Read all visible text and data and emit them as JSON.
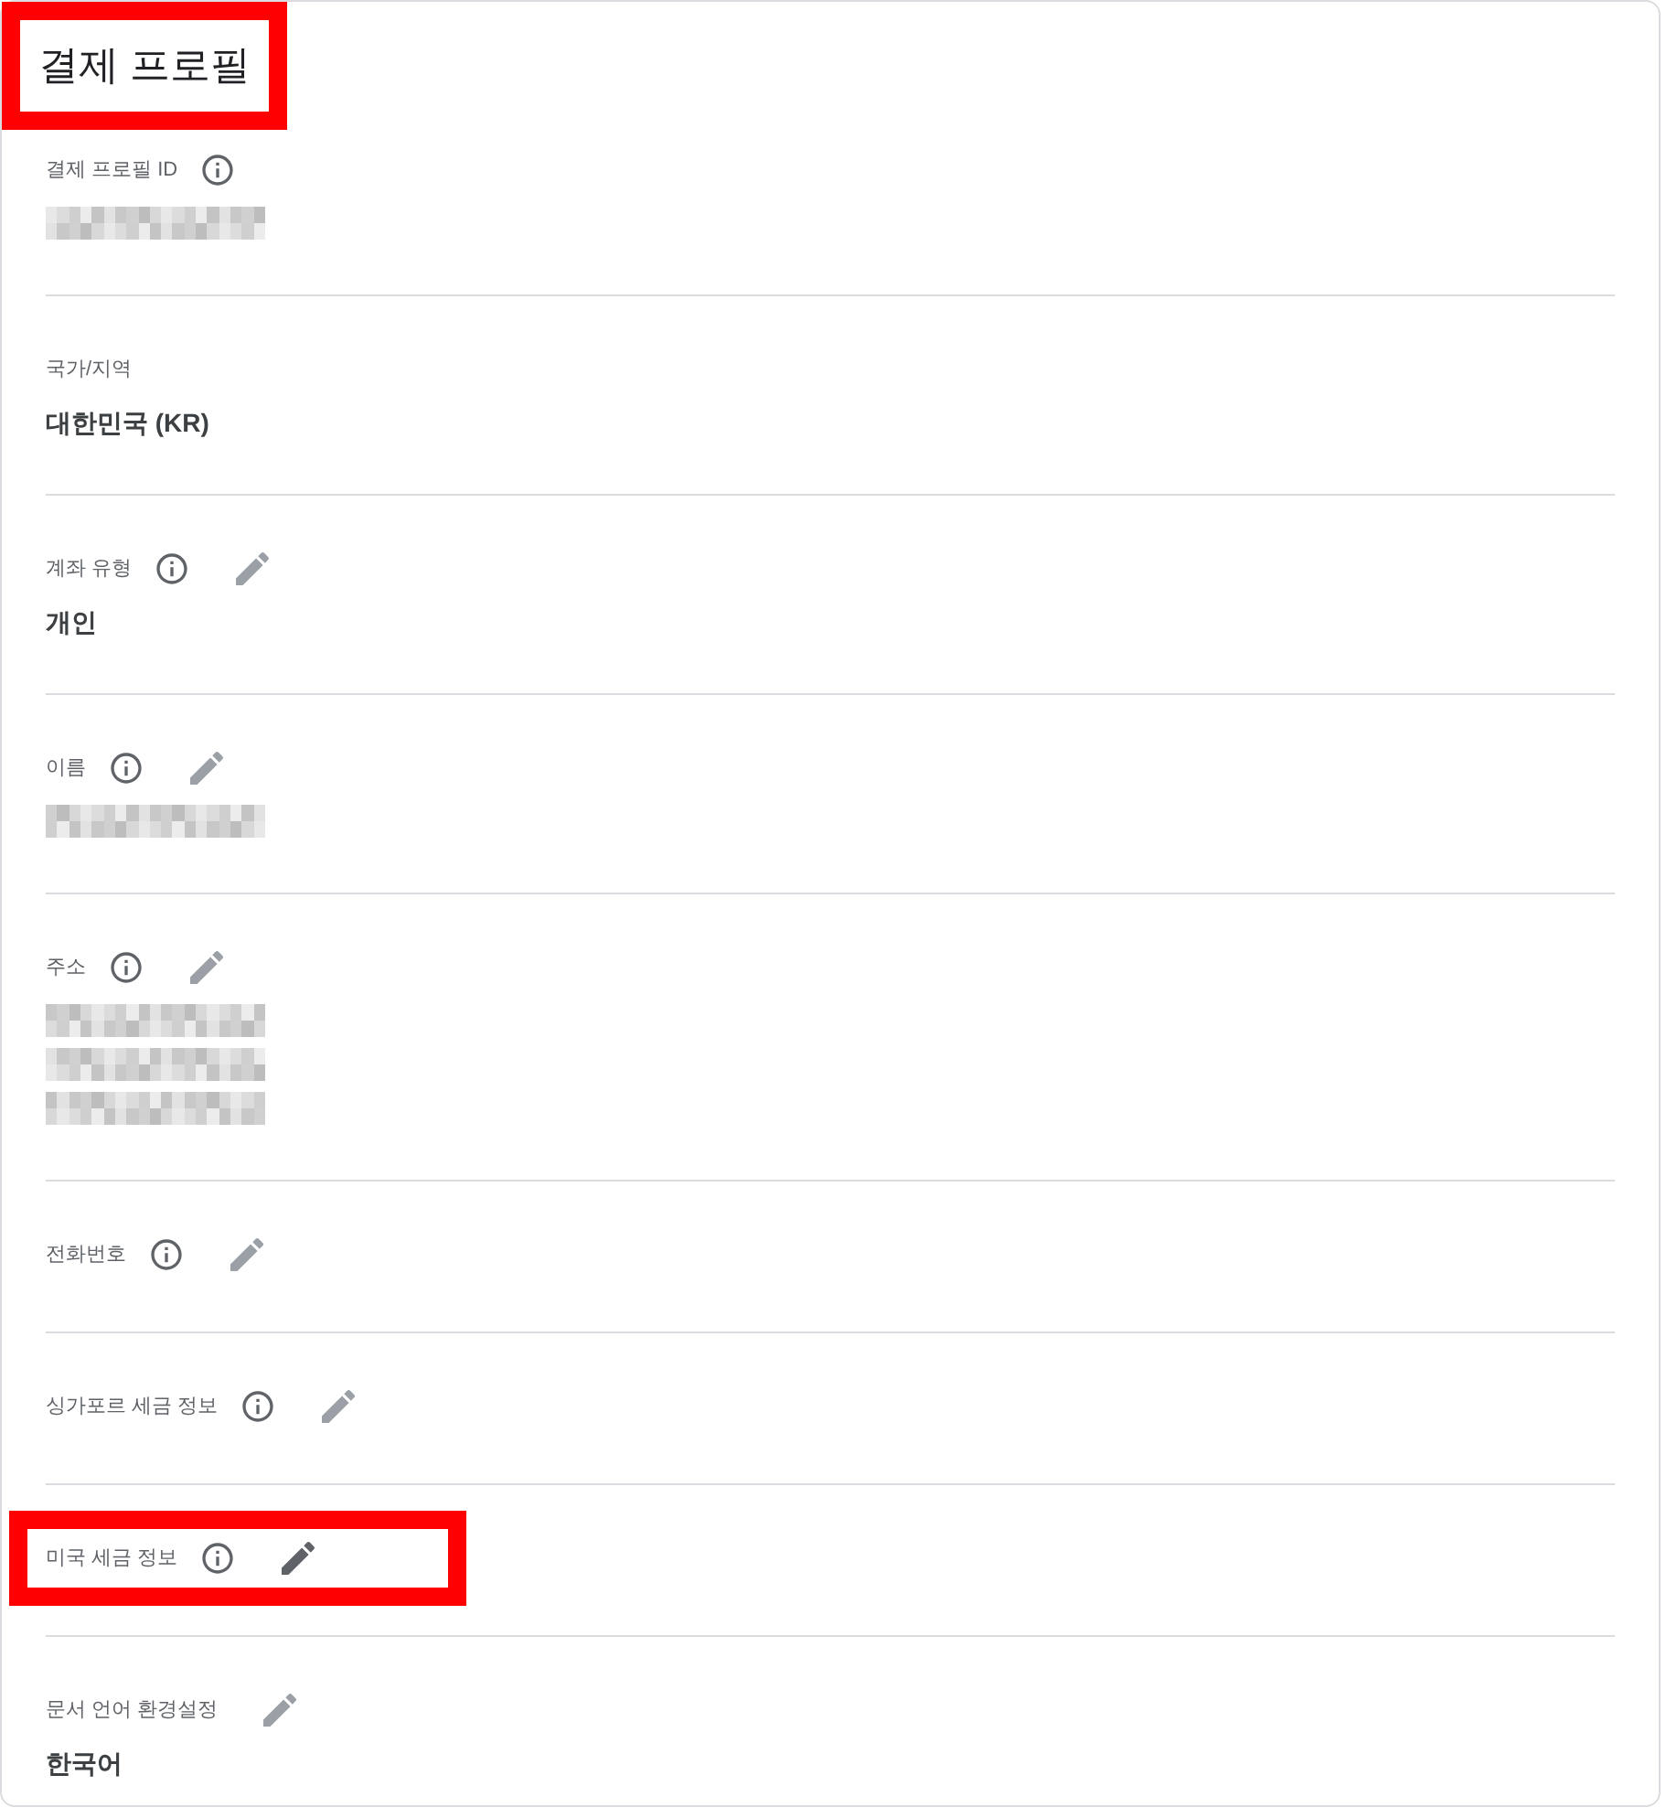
{
  "title": {
    "text": "결제 프로필",
    "highlighted": true
  },
  "sections": [
    {
      "label": "결제 프로필 ID",
      "info": true,
      "editable": false,
      "highlighted": false,
      "values": [
        {
          "kind": "redacted"
        }
      ]
    },
    {
      "label": "국가/지역",
      "info": false,
      "editable": false,
      "highlighted": false,
      "values": [
        {
          "kind": "text",
          "text": "대한민국 (KR)"
        }
      ]
    },
    {
      "label": "계좌 유형",
      "info": true,
      "editable": true,
      "highlighted": false,
      "values": [
        {
          "kind": "text",
          "text": "개인"
        }
      ]
    },
    {
      "label": "이름",
      "info": true,
      "editable": true,
      "highlighted": false,
      "values": [
        {
          "kind": "redacted"
        }
      ]
    },
    {
      "label": "주소",
      "info": true,
      "editable": true,
      "highlighted": false,
      "values": [
        {
          "kind": "redacted"
        },
        {
          "kind": "redacted"
        },
        {
          "kind": "redacted"
        }
      ]
    },
    {
      "label": "전화번호",
      "info": true,
      "editable": true,
      "highlighted": false
    },
    {
      "label": "싱가포르 세금 정보",
      "info": true,
      "editable": true,
      "highlighted": false
    },
    {
      "label": "미국 세금 정보",
      "info": true,
      "editable": true,
      "highlighted": true
    },
    {
      "label": "문서 언어 환경설정",
      "info": false,
      "editable": true,
      "highlighted": false,
      "values": [
        {
          "kind": "text",
          "text": "한국어"
        }
      ]
    }
  ]
}
